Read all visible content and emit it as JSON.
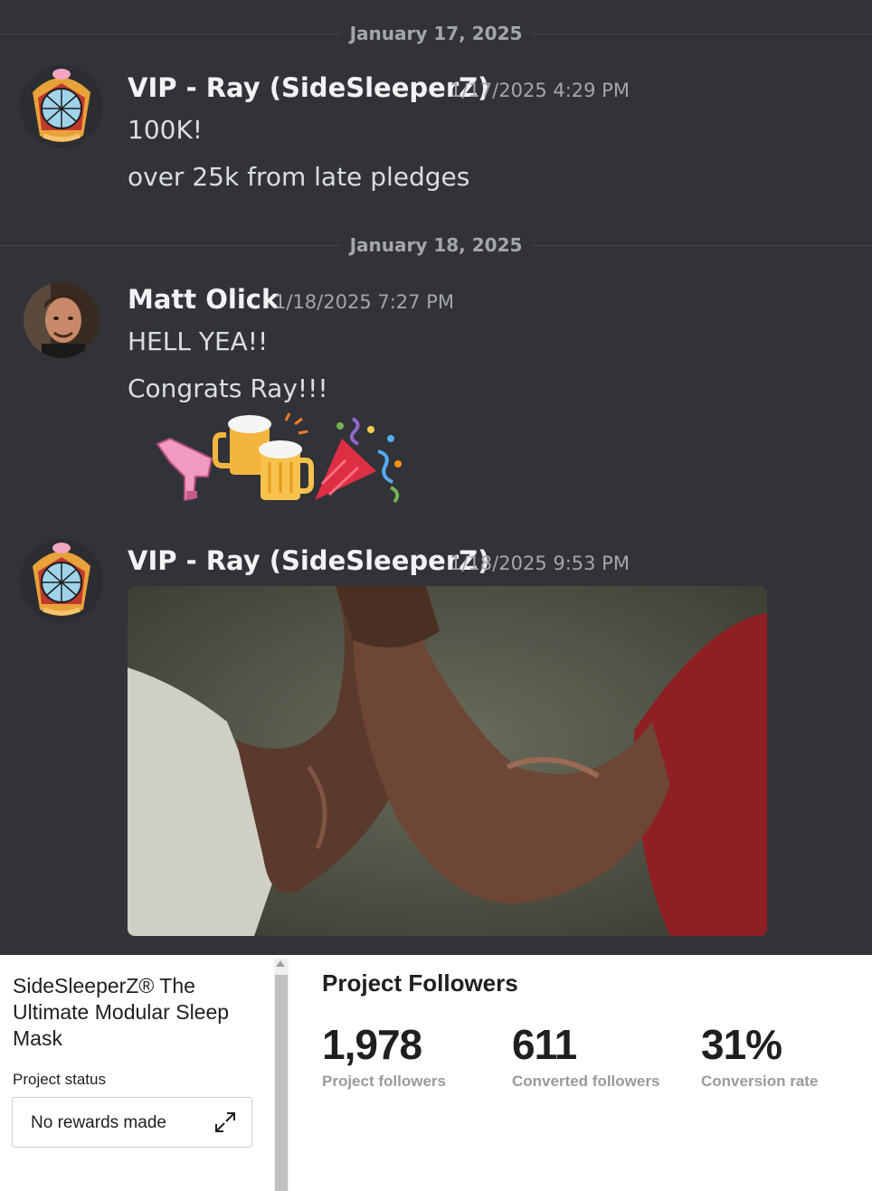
{
  "chat": {
    "dividers": [
      {
        "label": "January 17, 2025"
      },
      {
        "label": "January 18, 2025"
      }
    ],
    "messages": [
      {
        "author": "VIP - Ray (SideSleeperZ)",
        "timestamp": "1/17/2025 4:29 PM",
        "lines": [
          "100K!",
          "over 25k from late pledges"
        ]
      },
      {
        "author": "Matt Olick",
        "timestamp": "1/18/2025 7:27 PM",
        "lines": [
          "HELL YEA!!",
          "Congrats Ray!!!"
        ],
        "reactions": [
          "ray-gun-icon",
          "beer-mugs-icon",
          "party-popper-icon"
        ]
      },
      {
        "author": "VIP - Ray (SideSleeperZ)",
        "timestamp": "1/18/2025 9:53 PM",
        "attachment": "handshake-gif"
      }
    ]
  },
  "dashboard": {
    "project_title": "SideSleeperZ® The Ultimate Modular Sleep Mask",
    "project_status_label": "Project status",
    "status_value": "No rewards made",
    "followers_title": "Project Followers",
    "stats": [
      {
        "value": "1,978",
        "label": "Project followers"
      },
      {
        "value": "611",
        "label": "Converted followers"
      },
      {
        "value": "31%",
        "label": "Conversion rate"
      }
    ]
  },
  "colors": {
    "chat_bg": "#313338",
    "name_text": "#f2f3f5",
    "message_text": "#dbdee1",
    "muted_text": "#a3a6aa",
    "dashboard_bg": "#ffffff"
  }
}
